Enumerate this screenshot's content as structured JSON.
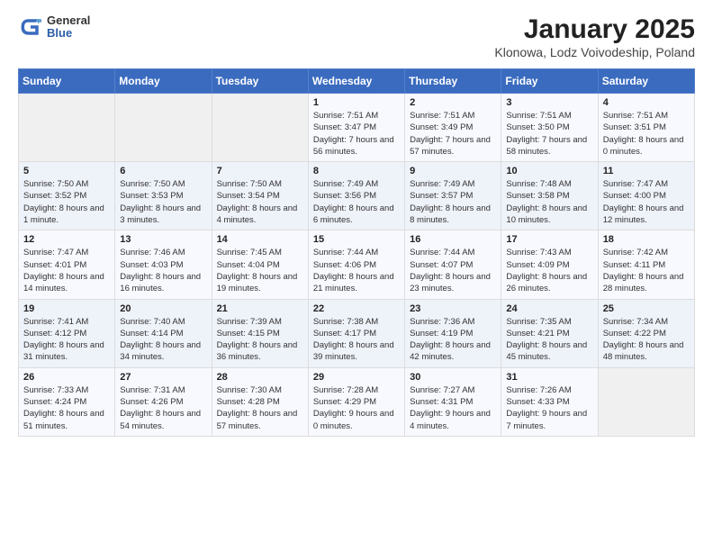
{
  "header": {
    "logo_general": "General",
    "logo_blue": "Blue",
    "title": "January 2025",
    "subtitle": "Klonowa, Lodz Voivodeship, Poland"
  },
  "weekdays": [
    "Sunday",
    "Monday",
    "Tuesday",
    "Wednesday",
    "Thursday",
    "Friday",
    "Saturday"
  ],
  "weeks": [
    [
      {
        "day": "",
        "info": ""
      },
      {
        "day": "",
        "info": ""
      },
      {
        "day": "",
        "info": ""
      },
      {
        "day": "1",
        "info": "Sunrise: 7:51 AM\nSunset: 3:47 PM\nDaylight: 7 hours and 56 minutes."
      },
      {
        "day": "2",
        "info": "Sunrise: 7:51 AM\nSunset: 3:49 PM\nDaylight: 7 hours and 57 minutes."
      },
      {
        "day": "3",
        "info": "Sunrise: 7:51 AM\nSunset: 3:50 PM\nDaylight: 7 hours and 58 minutes."
      },
      {
        "day": "4",
        "info": "Sunrise: 7:51 AM\nSunset: 3:51 PM\nDaylight: 8 hours and 0 minutes."
      }
    ],
    [
      {
        "day": "5",
        "info": "Sunrise: 7:50 AM\nSunset: 3:52 PM\nDaylight: 8 hours and 1 minute."
      },
      {
        "day": "6",
        "info": "Sunrise: 7:50 AM\nSunset: 3:53 PM\nDaylight: 8 hours and 3 minutes."
      },
      {
        "day": "7",
        "info": "Sunrise: 7:50 AM\nSunset: 3:54 PM\nDaylight: 8 hours and 4 minutes."
      },
      {
        "day": "8",
        "info": "Sunrise: 7:49 AM\nSunset: 3:56 PM\nDaylight: 8 hours and 6 minutes."
      },
      {
        "day": "9",
        "info": "Sunrise: 7:49 AM\nSunset: 3:57 PM\nDaylight: 8 hours and 8 minutes."
      },
      {
        "day": "10",
        "info": "Sunrise: 7:48 AM\nSunset: 3:58 PM\nDaylight: 8 hours and 10 minutes."
      },
      {
        "day": "11",
        "info": "Sunrise: 7:47 AM\nSunset: 4:00 PM\nDaylight: 8 hours and 12 minutes."
      }
    ],
    [
      {
        "day": "12",
        "info": "Sunrise: 7:47 AM\nSunset: 4:01 PM\nDaylight: 8 hours and 14 minutes."
      },
      {
        "day": "13",
        "info": "Sunrise: 7:46 AM\nSunset: 4:03 PM\nDaylight: 8 hours and 16 minutes."
      },
      {
        "day": "14",
        "info": "Sunrise: 7:45 AM\nSunset: 4:04 PM\nDaylight: 8 hours and 19 minutes."
      },
      {
        "day": "15",
        "info": "Sunrise: 7:44 AM\nSunset: 4:06 PM\nDaylight: 8 hours and 21 minutes."
      },
      {
        "day": "16",
        "info": "Sunrise: 7:44 AM\nSunset: 4:07 PM\nDaylight: 8 hours and 23 minutes."
      },
      {
        "day": "17",
        "info": "Sunrise: 7:43 AM\nSunset: 4:09 PM\nDaylight: 8 hours and 26 minutes."
      },
      {
        "day": "18",
        "info": "Sunrise: 7:42 AM\nSunset: 4:11 PM\nDaylight: 8 hours and 28 minutes."
      }
    ],
    [
      {
        "day": "19",
        "info": "Sunrise: 7:41 AM\nSunset: 4:12 PM\nDaylight: 8 hours and 31 minutes."
      },
      {
        "day": "20",
        "info": "Sunrise: 7:40 AM\nSunset: 4:14 PM\nDaylight: 8 hours and 34 minutes."
      },
      {
        "day": "21",
        "info": "Sunrise: 7:39 AM\nSunset: 4:15 PM\nDaylight: 8 hours and 36 minutes."
      },
      {
        "day": "22",
        "info": "Sunrise: 7:38 AM\nSunset: 4:17 PM\nDaylight: 8 hours and 39 minutes."
      },
      {
        "day": "23",
        "info": "Sunrise: 7:36 AM\nSunset: 4:19 PM\nDaylight: 8 hours and 42 minutes."
      },
      {
        "day": "24",
        "info": "Sunrise: 7:35 AM\nSunset: 4:21 PM\nDaylight: 8 hours and 45 minutes."
      },
      {
        "day": "25",
        "info": "Sunrise: 7:34 AM\nSunset: 4:22 PM\nDaylight: 8 hours and 48 minutes."
      }
    ],
    [
      {
        "day": "26",
        "info": "Sunrise: 7:33 AM\nSunset: 4:24 PM\nDaylight: 8 hours and 51 minutes."
      },
      {
        "day": "27",
        "info": "Sunrise: 7:31 AM\nSunset: 4:26 PM\nDaylight: 8 hours and 54 minutes."
      },
      {
        "day": "28",
        "info": "Sunrise: 7:30 AM\nSunset: 4:28 PM\nDaylight: 8 hours and 57 minutes."
      },
      {
        "day": "29",
        "info": "Sunrise: 7:28 AM\nSunset: 4:29 PM\nDaylight: 9 hours and 0 minutes."
      },
      {
        "day": "30",
        "info": "Sunrise: 7:27 AM\nSunset: 4:31 PM\nDaylight: 9 hours and 4 minutes."
      },
      {
        "day": "31",
        "info": "Sunrise: 7:26 AM\nSunset: 4:33 PM\nDaylight: 9 hours and 7 minutes."
      },
      {
        "day": "",
        "info": ""
      }
    ]
  ]
}
